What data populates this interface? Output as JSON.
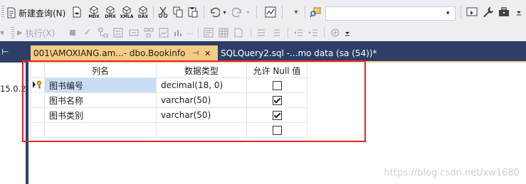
{
  "toolbar1": {
    "new_query_label": "新建查询(N)",
    "mdx_label": "MDX",
    "dmx_label": "DMX",
    "xmla_label": "XMLA",
    "dax_label": "DAX",
    "search_value": ""
  },
  "toolbar2": {
    "execute_label": "执行(X)"
  },
  "left_pane": {
    "version_text": "15.0.2"
  },
  "tabs": [
    {
      "label": "001\\AMOXIANG.am...- dbo.Bookinfo",
      "pin": "⊣",
      "close": "✕",
      "active": true
    },
    {
      "label": "SQLQuery2.sql -...mo data (sa (54))*",
      "active": false
    }
  ],
  "grid": {
    "headers": [
      "列名",
      "数据类型",
      "允许 Null 值"
    ],
    "rows": [
      {
        "name": "图书编号",
        "type": "decimal(18, 0)",
        "allow_null": false,
        "key": true
      },
      {
        "name": "图书名称",
        "type": "varchar(50)",
        "allow_null": true,
        "key": false
      },
      {
        "name": "图书类别",
        "type": "varchar(50)",
        "allow_null": true,
        "key": false
      },
      {
        "name": "",
        "type": "",
        "allow_null": false,
        "key": false
      }
    ]
  },
  "watermark": "https://blog.csdn.net/xw1680",
  "colors": {
    "tab_active": "#f5cc84",
    "tabrow_bg": "#2d3f68",
    "highlight_box": "#e8262b",
    "selected_cell": "#c9def5"
  }
}
